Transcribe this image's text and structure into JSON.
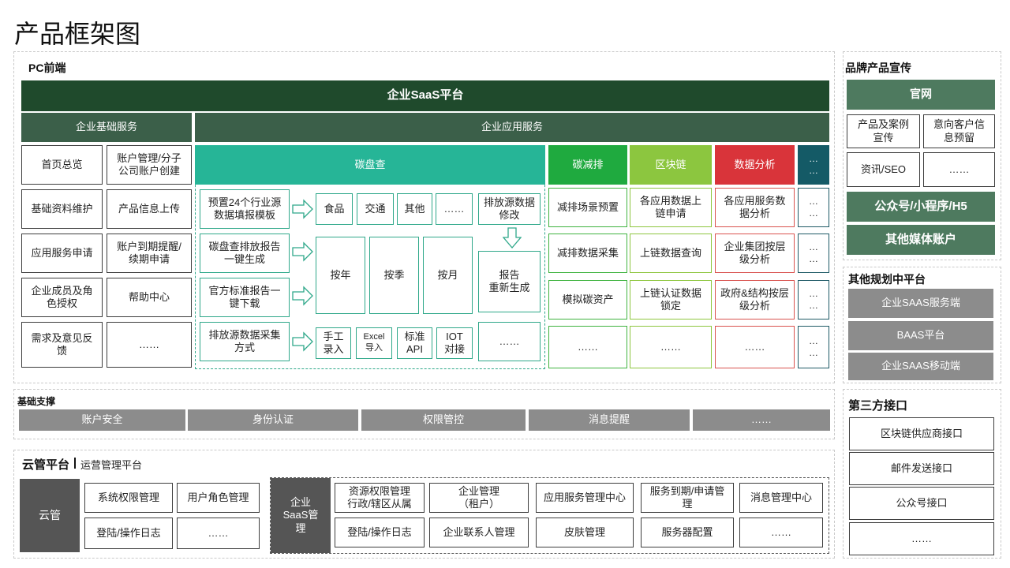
{
  "title": "产品框架图",
  "pc": {
    "label": "PC前端",
    "platform": "企业SaaS平台",
    "basic_header": "企业基础服务",
    "app_header": "企业应用服务",
    "basic_items": [
      "首页总览",
      "账户管理/分子公司账户创建",
      "基础资料维护",
      "产品信息上传",
      "应用服务申请",
      "账户到期提醒/续期申请",
      "企业成员及角色授权",
      "帮助中心",
      "需求及意见反馈",
      "……"
    ],
    "carbon_check": "碳盘查",
    "carbon_reduce": "碳减排",
    "blockchain": "区块链",
    "data_analysis": "数据分析",
    "more_dots": "…\n…",
    "check_left": [
      "预置24个行业源数据填报模板",
      "碳盘查排放报告一键生成",
      "官方标准报告一键下载",
      "排放源数据采集方式"
    ],
    "industries": [
      "食品",
      "交通",
      "其他",
      "……"
    ],
    "modify": "排放源数据修改",
    "periods": [
      "按年",
      "按季",
      "按月"
    ],
    "regen": "报告\n重新生成",
    "collect": [
      "手工\n录入",
      "Excel\n导入",
      "标准\nAPI",
      "IOT\n对接"
    ],
    "collect_more": "……",
    "reduce_items": [
      "减排场景预置",
      "减排数据采集",
      "模拟碳资产",
      "……"
    ],
    "chain_items": [
      "各应用数据上链申请",
      "上链数据查询",
      "上链认证数据锁定",
      "……"
    ],
    "analysis_items": [
      "各应用服务数据分析",
      "企业集团按层级分析",
      "政府&结构按层级分析",
      "……"
    ]
  },
  "brand": {
    "label": "品牌产品宣传",
    "website": "官网",
    "items": [
      "产品及案例宣传",
      "意向客户信息预留",
      "资讯/SEO",
      "……"
    ],
    "mini": "公众号/小程序/H5",
    "media": "其他媒体账户"
  },
  "other_platform": {
    "label": "其他规划中平台",
    "items": [
      "企业SAAS服务端",
      "BAAS平台",
      "企业SAAS移动端"
    ]
  },
  "base_support": {
    "label": "基础支撑",
    "items": [
      "账户安全",
      "身份认证",
      "权限管控",
      "消息提醒",
      "……"
    ]
  },
  "cloud": {
    "label": "云管平台",
    "sub": "运营管理平台",
    "cloud_mgmt": "云管",
    "cloud_items": [
      "系统权限管理",
      "用户角色管理",
      "登陆/操作日志",
      "……"
    ],
    "saas_mgmt": "企业\nSaaS管\n理",
    "saas_items": [
      "资源权限管理\n行政/辖区从属",
      "企业管理\n（租户）",
      "应用服务管理中心",
      "服务到期/申请管理",
      "消息管理中心",
      "登陆/操作日志",
      "企业联系人管理",
      "皮肤管理",
      "服务器配置",
      "……"
    ]
  },
  "third": {
    "label": "第三方接口",
    "items": [
      "区块链供应商接口",
      "邮件发送接口",
      "公众号接口",
      "……"
    ]
  },
  "colors": {
    "dark_green": "#1f4a2c",
    "teal": "#26b597",
    "green": "#1faa3f",
    "lime": "#8cc63f",
    "red": "#d9343a",
    "petrol": "#145a66",
    "gray": "#8c8c8c"
  }
}
